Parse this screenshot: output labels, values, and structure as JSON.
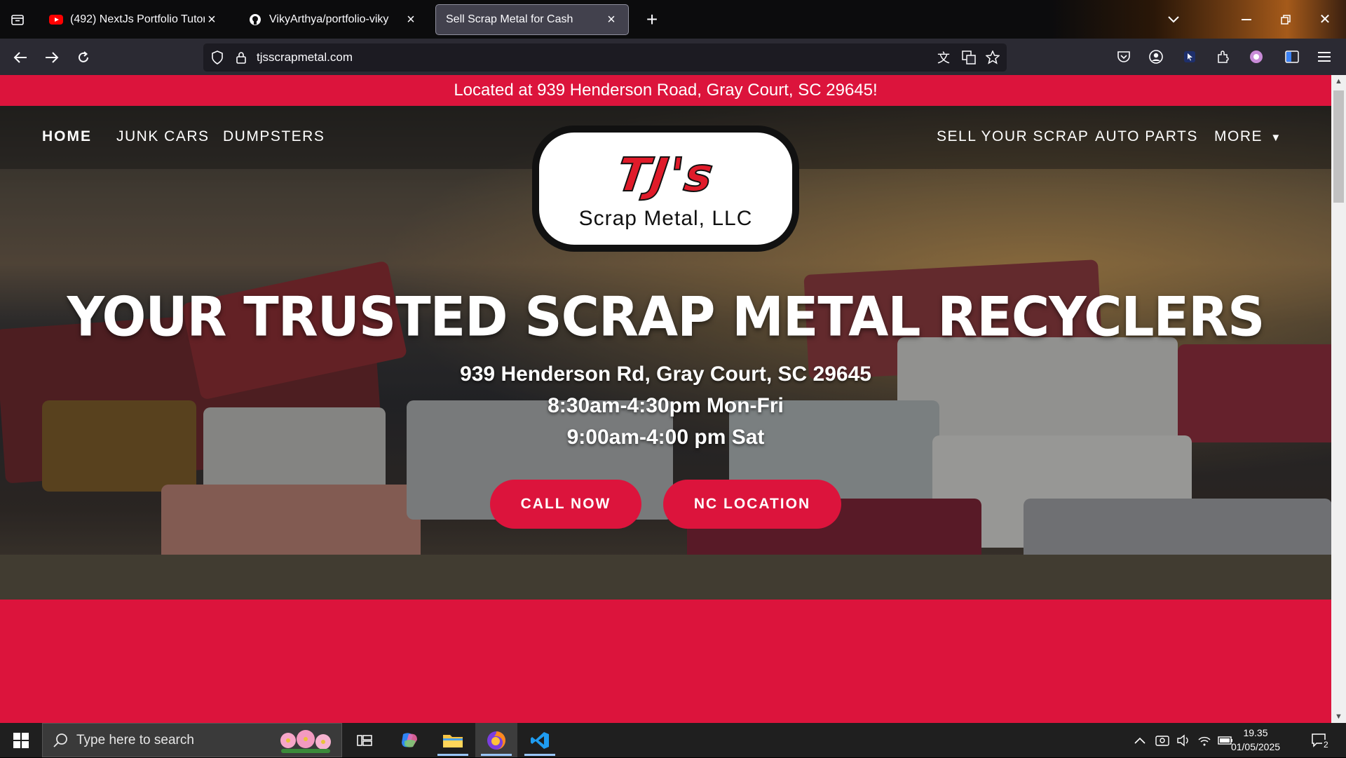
{
  "browser": {
    "tabs": [
      {
        "title": "(492) NextJs Portfolio Tutorial -",
        "icon": "youtube-icon",
        "active": false
      },
      {
        "title": "VikyArthya/portfolio-viky",
        "icon": "github-icon",
        "active": false
      },
      {
        "title": "Sell Scrap Metal for Cash",
        "icon": "",
        "active": true
      }
    ],
    "url": "tjsscrapmetal.com"
  },
  "site": {
    "announcement": "Located at 939 Henderson Road, Gray Court, SC 29645!",
    "nav_left": [
      "HOME",
      "JUNK CARS",
      "DUMPSTERS"
    ],
    "nav_right": [
      "SELL YOUR SCRAP",
      "AUTO PARTS",
      "MORE"
    ],
    "logo_brand": "TJ's",
    "logo_sub": "Scrap Metal, LLC",
    "headline": "YOUR TRUSTED SCRAP METAL RECYCLERS",
    "address": "939 Henderson Rd, Gray Court, SC 29645",
    "hours_weekday": "8:30am-4:30pm Mon-Fri",
    "hours_sat": "9:00am-4:00 pm Sat",
    "cta_call": "CALL NOW",
    "cta_nc": "NC LOCATION",
    "brand_color": "#dc143c"
  },
  "taskbar": {
    "search_placeholder": "Type here to search",
    "time": "19.35",
    "date": "01/05/2025",
    "notification_count": "2"
  }
}
